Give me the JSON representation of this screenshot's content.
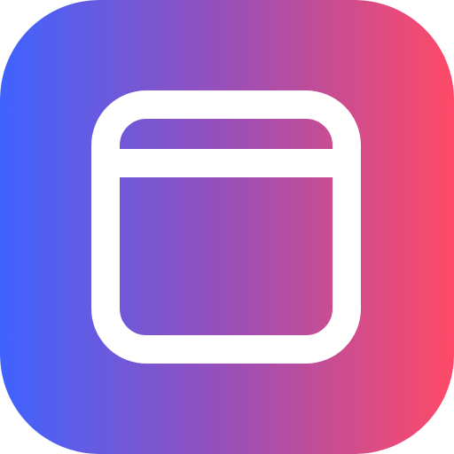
{
  "app_icon": {
    "name": "window-app-icon",
    "glyph": "browser-window-icon",
    "colors": {
      "gradient_start": "#3f63ff",
      "gradient_mid": "#9a4fb8",
      "gradient_end": "#ff4a67",
      "glyph_stroke": "#ffffff"
    }
  }
}
